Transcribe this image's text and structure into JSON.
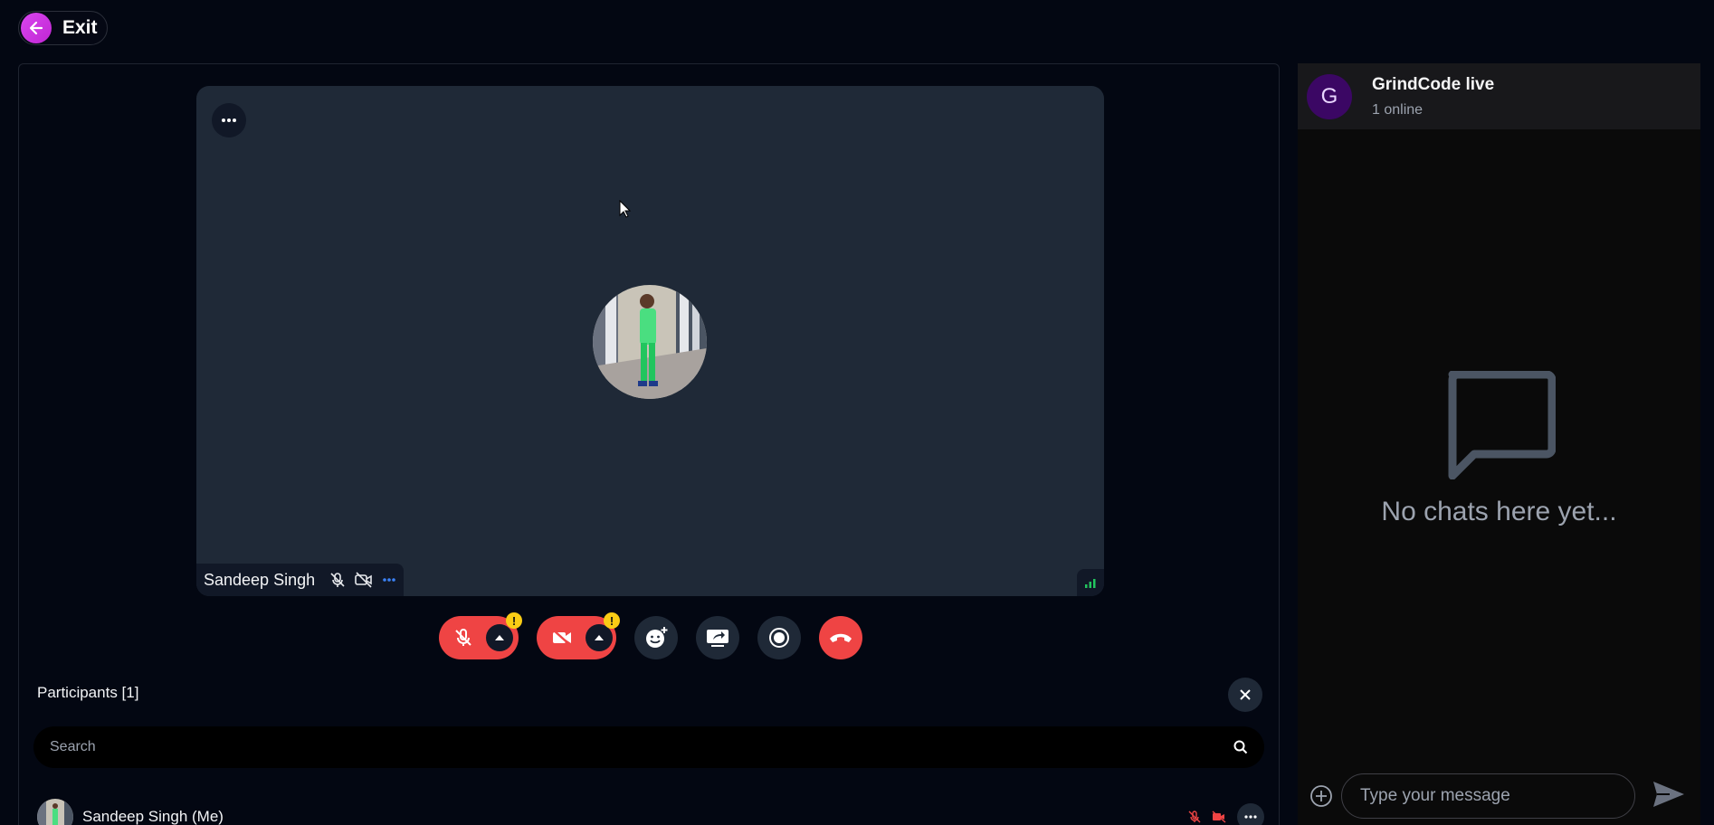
{
  "topbar": {
    "exit_label": "Exit"
  },
  "stage": {
    "tile_name": "Sandeep Singh"
  },
  "participants": {
    "title": "Participants [1]",
    "search_placeholder": "Search",
    "rows": [
      {
        "name": "Sandeep Singh (Me)"
      }
    ]
  },
  "chat": {
    "avatar_letter": "G",
    "title": "GrindCode live",
    "subtitle": "1 online",
    "empty_text": "No chats here yet...",
    "input_placeholder": "Type your message"
  },
  "colors": {
    "background": "#030712",
    "tile": "#1f2937",
    "danger": "#ef4444",
    "warning": "#facc15",
    "accent": "#d946ef"
  },
  "icons": [
    "arrow-left-icon",
    "more-horizontal-icon",
    "mic-off-icon",
    "video-off-icon",
    "caret-up-icon",
    "emoji-add-icon",
    "screen-share-icon",
    "record-icon",
    "phone-end-icon",
    "close-icon",
    "search-icon",
    "signal-icon",
    "chat-bubble-icon",
    "plus-circle-icon",
    "send-icon"
  ]
}
